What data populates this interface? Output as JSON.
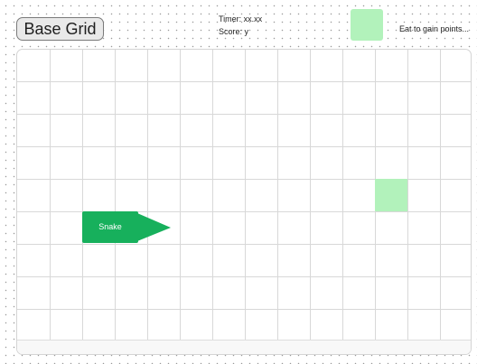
{
  "header": {
    "title": "Base Grid",
    "timer": "Timer: xx.xx",
    "score": "Score: y",
    "food_hint": "Eat to gain points..."
  },
  "board": {
    "columns": 14,
    "rows": 9,
    "snake_label": "Snake",
    "snake_direction": "right"
  },
  "colors": {
    "food": "#b2f2bb",
    "snake": "#17b05c",
    "grid_line": "#d8d8d8"
  }
}
